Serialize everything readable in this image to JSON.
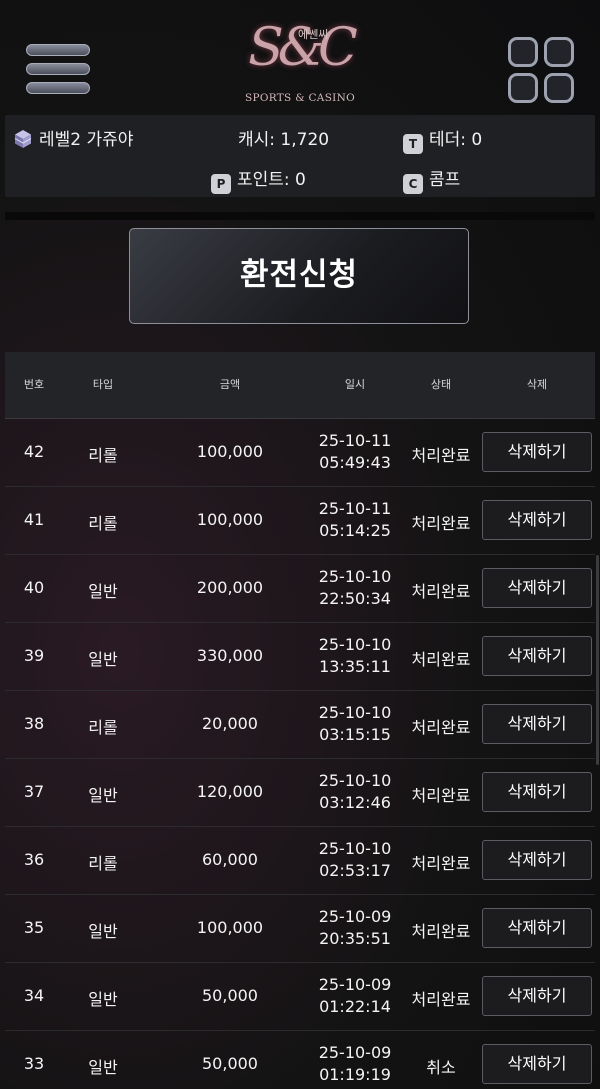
{
  "header": {
    "logo_monogram": "S&C",
    "logo_hangul": "에쎈씨",
    "logo_subtitle": "SPORTS & CASINO"
  },
  "user_info": {
    "level": "레벨2 가쥬야",
    "cash": "캐시: 1,720",
    "tether": "테더: 0",
    "points": "포인트: 0",
    "comp": "콤프",
    "icons": {
      "level": "cube-icon",
      "tether": "t-badge-icon",
      "points": "p-badge-icon",
      "comp": "c-badge-icon"
    },
    "tether_badge": "T",
    "points_badge": "P",
    "comp_badge": "C"
  },
  "exchange_button": "환전신청",
  "table": {
    "headers": [
      "번호",
      "타입",
      "금액",
      "일시",
      "상태",
      "삭제"
    ],
    "delete_label": "삭제하기",
    "rows": [
      {
        "num": "42",
        "type": "리롤",
        "amount": "100,000",
        "date": "25-10-11",
        "time": "05:49:43",
        "status": "처리완료",
        "delete": "삭제하기"
      },
      {
        "num": "41",
        "type": "리롤",
        "amount": "100,000",
        "date": "25-10-11",
        "time": "05:14:25",
        "status": "처리완료",
        "delete": "삭제하기"
      },
      {
        "num": "40",
        "type": "일반",
        "amount": "200,000",
        "date": "25-10-10",
        "time": "22:50:34",
        "status": "처리완료",
        "delete": "삭제하기"
      },
      {
        "num": "39",
        "type": "일반",
        "amount": "330,000",
        "date": "25-10-10",
        "time": "13:35:11",
        "status": "처리완료",
        "delete": "삭제하기"
      },
      {
        "num": "38",
        "type": "리롤",
        "amount": "20,000",
        "date": "25-10-10",
        "time": "03:15:15",
        "status": "처리완료",
        "delete": "삭제하기"
      },
      {
        "num": "37",
        "type": "일반",
        "amount": "120,000",
        "date": "25-10-10",
        "time": "03:12:46",
        "status": "처리완료",
        "delete": "삭제하기"
      },
      {
        "num": "36",
        "type": "리롤",
        "amount": "60,000",
        "date": "25-10-10",
        "time": "02:53:17",
        "status": "처리완료",
        "delete": "삭제하기"
      },
      {
        "num": "35",
        "type": "일반",
        "amount": "100,000",
        "date": "25-10-09",
        "time": "20:35:51",
        "status": "처리완료",
        "delete": "삭제하기"
      },
      {
        "num": "34",
        "type": "일반",
        "amount": "50,000",
        "date": "25-10-09",
        "time": "01:22:14",
        "status": "처리완료",
        "delete": "삭제하기"
      },
      {
        "num": "33",
        "type": "일반",
        "amount": "50,000",
        "date": "25-10-09",
        "time": "01:19:19",
        "status": "취소",
        "delete": "삭제하기"
      }
    ]
  }
}
